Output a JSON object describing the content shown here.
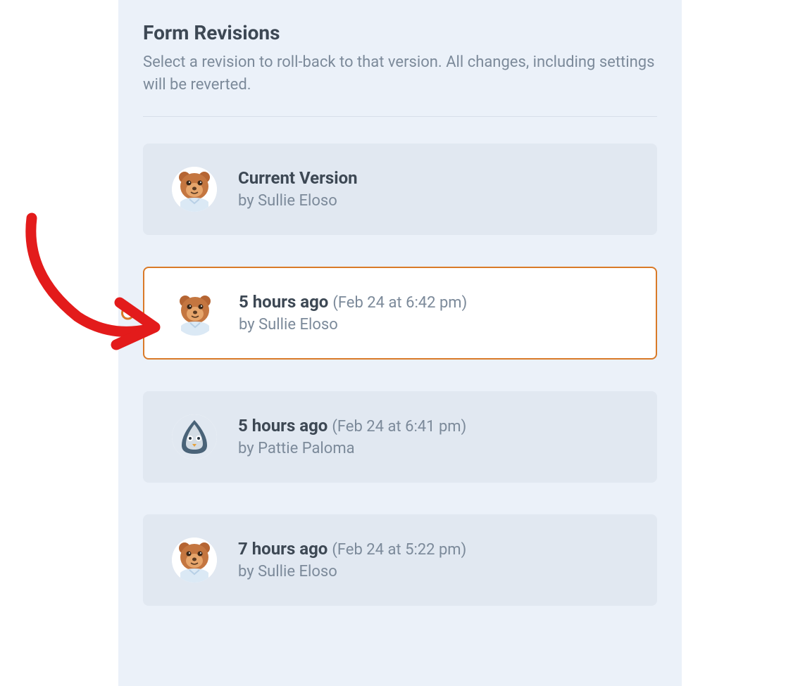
{
  "header": {
    "title": "Form Revisions",
    "subtitle": "Select a revision to roll-back to that version. All changes, including settings will be reverted."
  },
  "revisions": [
    {
      "avatar": "bear",
      "time": "Current Version",
      "timestamp": "",
      "byline": "by Sullie Eloso",
      "selected": false
    },
    {
      "avatar": "bear",
      "time": "5 hours ago",
      "timestamp": "(Feb 24 at 6:42 pm)",
      "byline": "by Sullie Eloso",
      "selected": true
    },
    {
      "avatar": "bird",
      "time": "5 hours ago",
      "timestamp": "(Feb 24 at 6:41 pm)",
      "byline": "by Pattie Paloma",
      "selected": false
    },
    {
      "avatar": "bear",
      "time": "7 hours ago",
      "timestamp": "(Feb 24 at 5:22 pm)",
      "byline": "by Sullie Eloso",
      "selected": false
    }
  ]
}
